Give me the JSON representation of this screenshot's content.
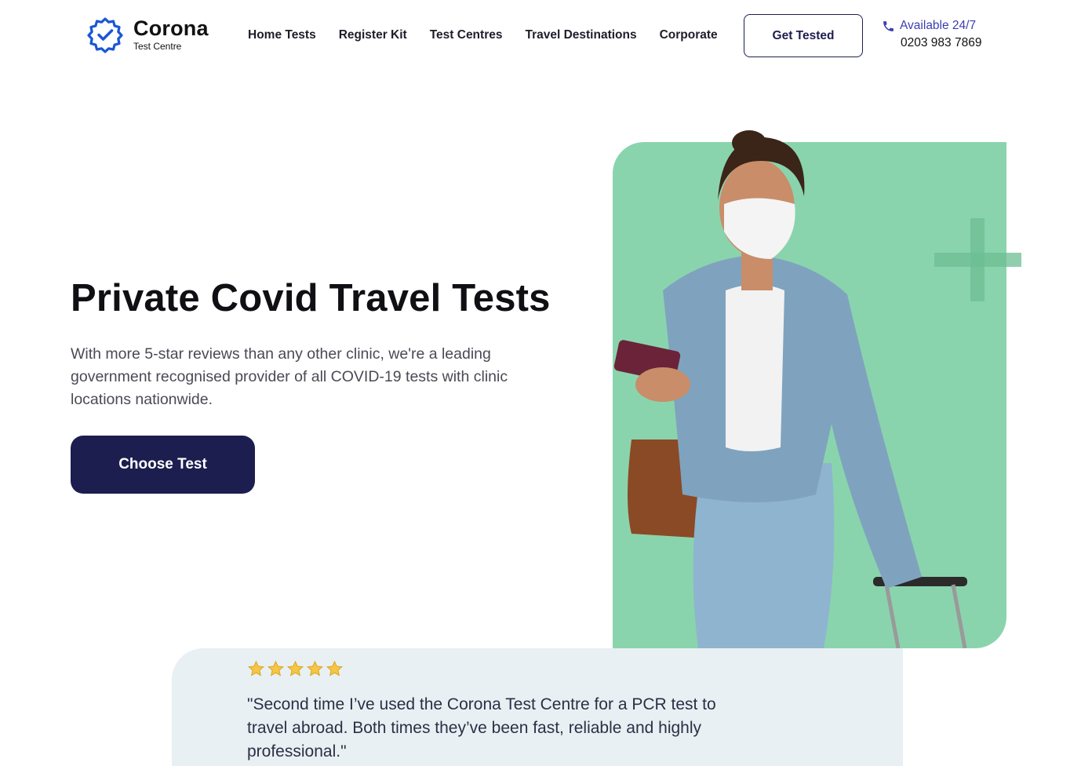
{
  "brand": {
    "name": "Corona",
    "subtitle": "Test Centre",
    "accent_color": "#1a56d6"
  },
  "nav": {
    "items": [
      {
        "label": "Home Tests"
      },
      {
        "label": "Register Kit"
      },
      {
        "label": "Test Centres"
      },
      {
        "label": "Travel Destinations"
      },
      {
        "label": "Corporate"
      }
    ]
  },
  "header": {
    "cta_label": "Get Tested",
    "availability": "Available 24/7",
    "phone": "0203 983 7869",
    "phone_icon": "phone-icon"
  },
  "hero": {
    "title": "Private Covid Travel Tests",
    "description": "With more 5-star reviews than any other clinic, we're a leading government recognised provider of all COVID-19 tests with clinic locations nationwide.",
    "cta_label": "Choose Test",
    "panel_color": "#8ad4ad",
    "button_color": "#1c1e4f"
  },
  "review": {
    "rating": 5,
    "star_icon": "star-icon",
    "text": "\"Second time I’ve used the Corona Test Centre for a PCR test to travel abroad. Both times they’ve been fast, reliable and highly professional.\""
  }
}
